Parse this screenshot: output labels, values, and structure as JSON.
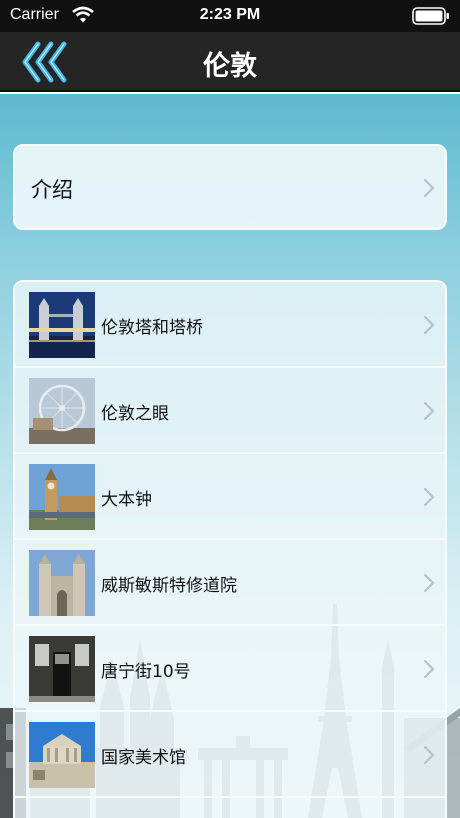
{
  "status_bar": {
    "carrier": "Carrier",
    "time": "2:23 PM"
  },
  "nav": {
    "title": "伦敦"
  },
  "intro": {
    "label": "介绍"
  },
  "places": [
    {
      "label": "伦敦塔和塔桥"
    },
    {
      "label": "伦敦之眼"
    },
    {
      "label": "大本钟"
    },
    {
      "label": "威斯敏斯特修道院"
    },
    {
      "label": "唐宁街10号"
    },
    {
      "label": "国家美术馆"
    }
  ],
  "colors": {
    "nav_bg": "#252525",
    "back_accent": "#3fb6e8",
    "sky_top": "#5eb9cf",
    "sky_bottom": "#eff8fa"
  },
  "icons": {
    "back": "triple-chevron-left-icon",
    "disclosure": "chevron-right-icon",
    "wifi": "wifi-icon",
    "battery": "battery-icon"
  }
}
